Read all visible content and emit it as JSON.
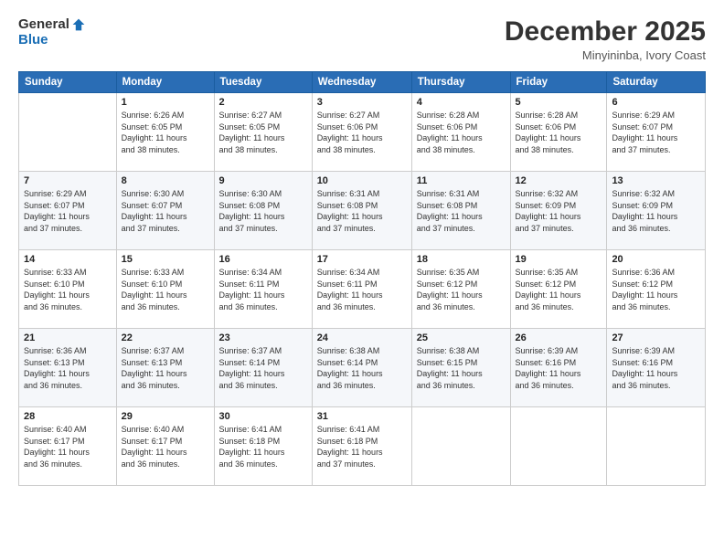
{
  "header": {
    "logo_general": "General",
    "logo_blue": "Blue",
    "month_title": "December 2025",
    "location": "Minyininba, Ivory Coast"
  },
  "weekdays": [
    "Sunday",
    "Monday",
    "Tuesday",
    "Wednesday",
    "Thursday",
    "Friday",
    "Saturday"
  ],
  "weeks": [
    [
      {
        "day": "",
        "info": ""
      },
      {
        "day": "1",
        "info": "Sunrise: 6:26 AM\nSunset: 6:05 PM\nDaylight: 11 hours\nand 38 minutes."
      },
      {
        "day": "2",
        "info": "Sunrise: 6:27 AM\nSunset: 6:05 PM\nDaylight: 11 hours\nand 38 minutes."
      },
      {
        "day": "3",
        "info": "Sunrise: 6:27 AM\nSunset: 6:06 PM\nDaylight: 11 hours\nand 38 minutes."
      },
      {
        "day": "4",
        "info": "Sunrise: 6:28 AM\nSunset: 6:06 PM\nDaylight: 11 hours\nand 38 minutes."
      },
      {
        "day": "5",
        "info": "Sunrise: 6:28 AM\nSunset: 6:06 PM\nDaylight: 11 hours\nand 38 minutes."
      },
      {
        "day": "6",
        "info": "Sunrise: 6:29 AM\nSunset: 6:07 PM\nDaylight: 11 hours\nand 37 minutes."
      }
    ],
    [
      {
        "day": "7",
        "info": "Sunrise: 6:29 AM\nSunset: 6:07 PM\nDaylight: 11 hours\nand 37 minutes."
      },
      {
        "day": "8",
        "info": "Sunrise: 6:30 AM\nSunset: 6:07 PM\nDaylight: 11 hours\nand 37 minutes."
      },
      {
        "day": "9",
        "info": "Sunrise: 6:30 AM\nSunset: 6:08 PM\nDaylight: 11 hours\nand 37 minutes."
      },
      {
        "day": "10",
        "info": "Sunrise: 6:31 AM\nSunset: 6:08 PM\nDaylight: 11 hours\nand 37 minutes."
      },
      {
        "day": "11",
        "info": "Sunrise: 6:31 AM\nSunset: 6:08 PM\nDaylight: 11 hours\nand 37 minutes."
      },
      {
        "day": "12",
        "info": "Sunrise: 6:32 AM\nSunset: 6:09 PM\nDaylight: 11 hours\nand 37 minutes."
      },
      {
        "day": "13",
        "info": "Sunrise: 6:32 AM\nSunset: 6:09 PM\nDaylight: 11 hours\nand 36 minutes."
      }
    ],
    [
      {
        "day": "14",
        "info": "Sunrise: 6:33 AM\nSunset: 6:10 PM\nDaylight: 11 hours\nand 36 minutes."
      },
      {
        "day": "15",
        "info": "Sunrise: 6:33 AM\nSunset: 6:10 PM\nDaylight: 11 hours\nand 36 minutes."
      },
      {
        "day": "16",
        "info": "Sunrise: 6:34 AM\nSunset: 6:11 PM\nDaylight: 11 hours\nand 36 minutes."
      },
      {
        "day": "17",
        "info": "Sunrise: 6:34 AM\nSunset: 6:11 PM\nDaylight: 11 hours\nand 36 minutes."
      },
      {
        "day": "18",
        "info": "Sunrise: 6:35 AM\nSunset: 6:12 PM\nDaylight: 11 hours\nand 36 minutes."
      },
      {
        "day": "19",
        "info": "Sunrise: 6:35 AM\nSunset: 6:12 PM\nDaylight: 11 hours\nand 36 minutes."
      },
      {
        "day": "20",
        "info": "Sunrise: 6:36 AM\nSunset: 6:12 PM\nDaylight: 11 hours\nand 36 minutes."
      }
    ],
    [
      {
        "day": "21",
        "info": "Sunrise: 6:36 AM\nSunset: 6:13 PM\nDaylight: 11 hours\nand 36 minutes."
      },
      {
        "day": "22",
        "info": "Sunrise: 6:37 AM\nSunset: 6:13 PM\nDaylight: 11 hours\nand 36 minutes."
      },
      {
        "day": "23",
        "info": "Sunrise: 6:37 AM\nSunset: 6:14 PM\nDaylight: 11 hours\nand 36 minutes."
      },
      {
        "day": "24",
        "info": "Sunrise: 6:38 AM\nSunset: 6:14 PM\nDaylight: 11 hours\nand 36 minutes."
      },
      {
        "day": "25",
        "info": "Sunrise: 6:38 AM\nSunset: 6:15 PM\nDaylight: 11 hours\nand 36 minutes."
      },
      {
        "day": "26",
        "info": "Sunrise: 6:39 AM\nSunset: 6:16 PM\nDaylight: 11 hours\nand 36 minutes."
      },
      {
        "day": "27",
        "info": "Sunrise: 6:39 AM\nSunset: 6:16 PM\nDaylight: 11 hours\nand 36 minutes."
      }
    ],
    [
      {
        "day": "28",
        "info": "Sunrise: 6:40 AM\nSunset: 6:17 PM\nDaylight: 11 hours\nand 36 minutes."
      },
      {
        "day": "29",
        "info": "Sunrise: 6:40 AM\nSunset: 6:17 PM\nDaylight: 11 hours\nand 36 minutes."
      },
      {
        "day": "30",
        "info": "Sunrise: 6:41 AM\nSunset: 6:18 PM\nDaylight: 11 hours\nand 36 minutes."
      },
      {
        "day": "31",
        "info": "Sunrise: 6:41 AM\nSunset: 6:18 PM\nDaylight: 11 hours\nand 37 minutes."
      },
      {
        "day": "",
        "info": ""
      },
      {
        "day": "",
        "info": ""
      },
      {
        "day": "",
        "info": ""
      }
    ]
  ]
}
